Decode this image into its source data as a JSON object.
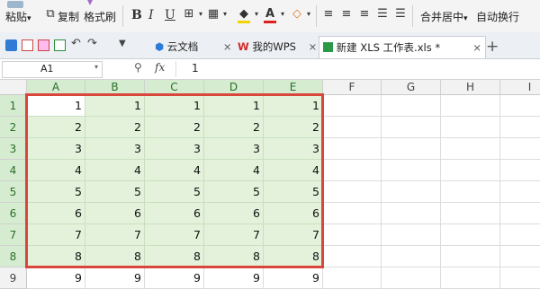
{
  "ribbon": {
    "paste": "粘贴",
    "copy": "复制",
    "format_painter": "格式刷",
    "bold": "B",
    "italic": "I",
    "underline": "U",
    "font_color_glyph": "A",
    "merge_center": "合并居中",
    "wrap_text": "自动换行"
  },
  "tabs": [
    {
      "label": "云文档",
      "close": "×"
    },
    {
      "label": "我的WPS",
      "close": "×"
    },
    {
      "label": "新建 XLS 工作表.xls *",
      "close": "×"
    }
  ],
  "new_tab": "+",
  "formula_bar": {
    "cell_ref": "A1",
    "fx": "fx",
    "value": "1"
  },
  "columns": [
    "A",
    "B",
    "C",
    "D",
    "E",
    "F",
    "G",
    "H",
    "I"
  ],
  "rows": [
    {
      "num": "1",
      "cells": [
        "1",
        "1",
        "1",
        "1",
        "1"
      ]
    },
    {
      "num": "2",
      "cells": [
        "2",
        "2",
        "2",
        "2",
        "2"
      ]
    },
    {
      "num": "3",
      "cells": [
        "3",
        "3",
        "3",
        "3",
        "3"
      ]
    },
    {
      "num": "4",
      "cells": [
        "4",
        "4",
        "4",
        "4",
        "4"
      ]
    },
    {
      "num": "5",
      "cells": [
        "5",
        "5",
        "5",
        "5",
        "5"
      ]
    },
    {
      "num": "6",
      "cells": [
        "6",
        "6",
        "6",
        "6",
        "6"
      ]
    },
    {
      "num": "7",
      "cells": [
        "7",
        "7",
        "7",
        "7",
        "7"
      ]
    },
    {
      "num": "8",
      "cells": [
        "8",
        "8",
        "8",
        "8",
        "8"
      ]
    },
    {
      "num": "9",
      "cells": [
        "9",
        "9",
        "9",
        "9",
        "9"
      ]
    }
  ],
  "selection": {
    "range": "A1:E8",
    "active_cell": "A1"
  },
  "colors": {
    "selection_fill": "#e4f2dc",
    "selection_border": "#d9473c",
    "header_selected": "#d6ecd0"
  }
}
